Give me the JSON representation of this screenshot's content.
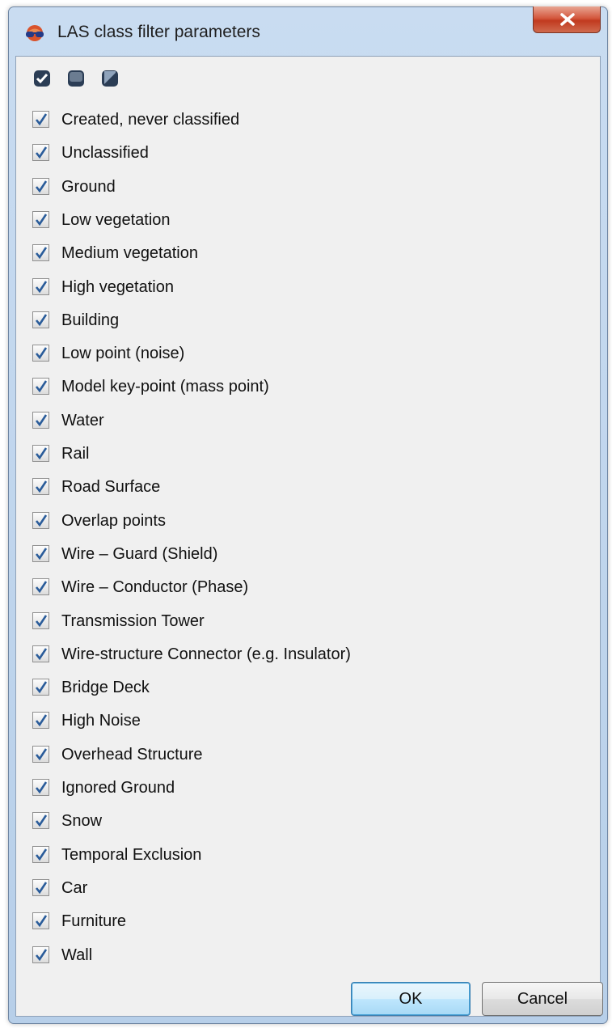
{
  "window": {
    "title": "LAS class filter parameters",
    "icons": {
      "app": "glasses-icon",
      "close": "close-x-icon"
    }
  },
  "toolbar": {
    "buttons": [
      {
        "name": "check-all-icon"
      },
      {
        "name": "uncheck-all-icon"
      },
      {
        "name": "invert-selection-icon"
      }
    ]
  },
  "classes": [
    {
      "label": "Created, never classified",
      "checked": true
    },
    {
      "label": "Unclassified",
      "checked": true
    },
    {
      "label": "Ground",
      "checked": true
    },
    {
      "label": "Low vegetation",
      "checked": true
    },
    {
      "label": "Medium vegetation",
      "checked": true
    },
    {
      "label": "High vegetation",
      "checked": true
    },
    {
      "label": "Building",
      "checked": true
    },
    {
      "label": "Low point (noise)",
      "checked": true
    },
    {
      "label": "Model key-point (mass point)",
      "checked": true
    },
    {
      "label": "Water",
      "checked": true
    },
    {
      "label": "Rail",
      "checked": true
    },
    {
      "label": "Road Surface",
      "checked": true
    },
    {
      "label": "Overlap points",
      "checked": true
    },
    {
      "label": "Wire – Guard (Shield)",
      "checked": true
    },
    {
      "label": "Wire – Conductor (Phase)",
      "checked": true
    },
    {
      "label": "Transmission Tower",
      "checked": true
    },
    {
      "label": "Wire-structure Connector (e.g. Insulator)",
      "checked": true
    },
    {
      "label": "Bridge Deck",
      "checked": true
    },
    {
      "label": "High Noise",
      "checked": true
    },
    {
      "label": "Overhead Structure",
      "checked": true
    },
    {
      "label": "Ignored Ground",
      "checked": true
    },
    {
      "label": "Snow",
      "checked": true
    },
    {
      "label": "Temporal Exclusion",
      "checked": true
    },
    {
      "label": "Car",
      "checked": true
    },
    {
      "label": "Furniture",
      "checked": true
    },
    {
      "label": "Wall",
      "checked": true
    }
  ],
  "buttons": {
    "ok": "OK",
    "cancel": "Cancel"
  },
  "colors": {
    "check": "#2a5c9a",
    "close": "#c9452a",
    "ok_border": "#3c7fb1"
  }
}
